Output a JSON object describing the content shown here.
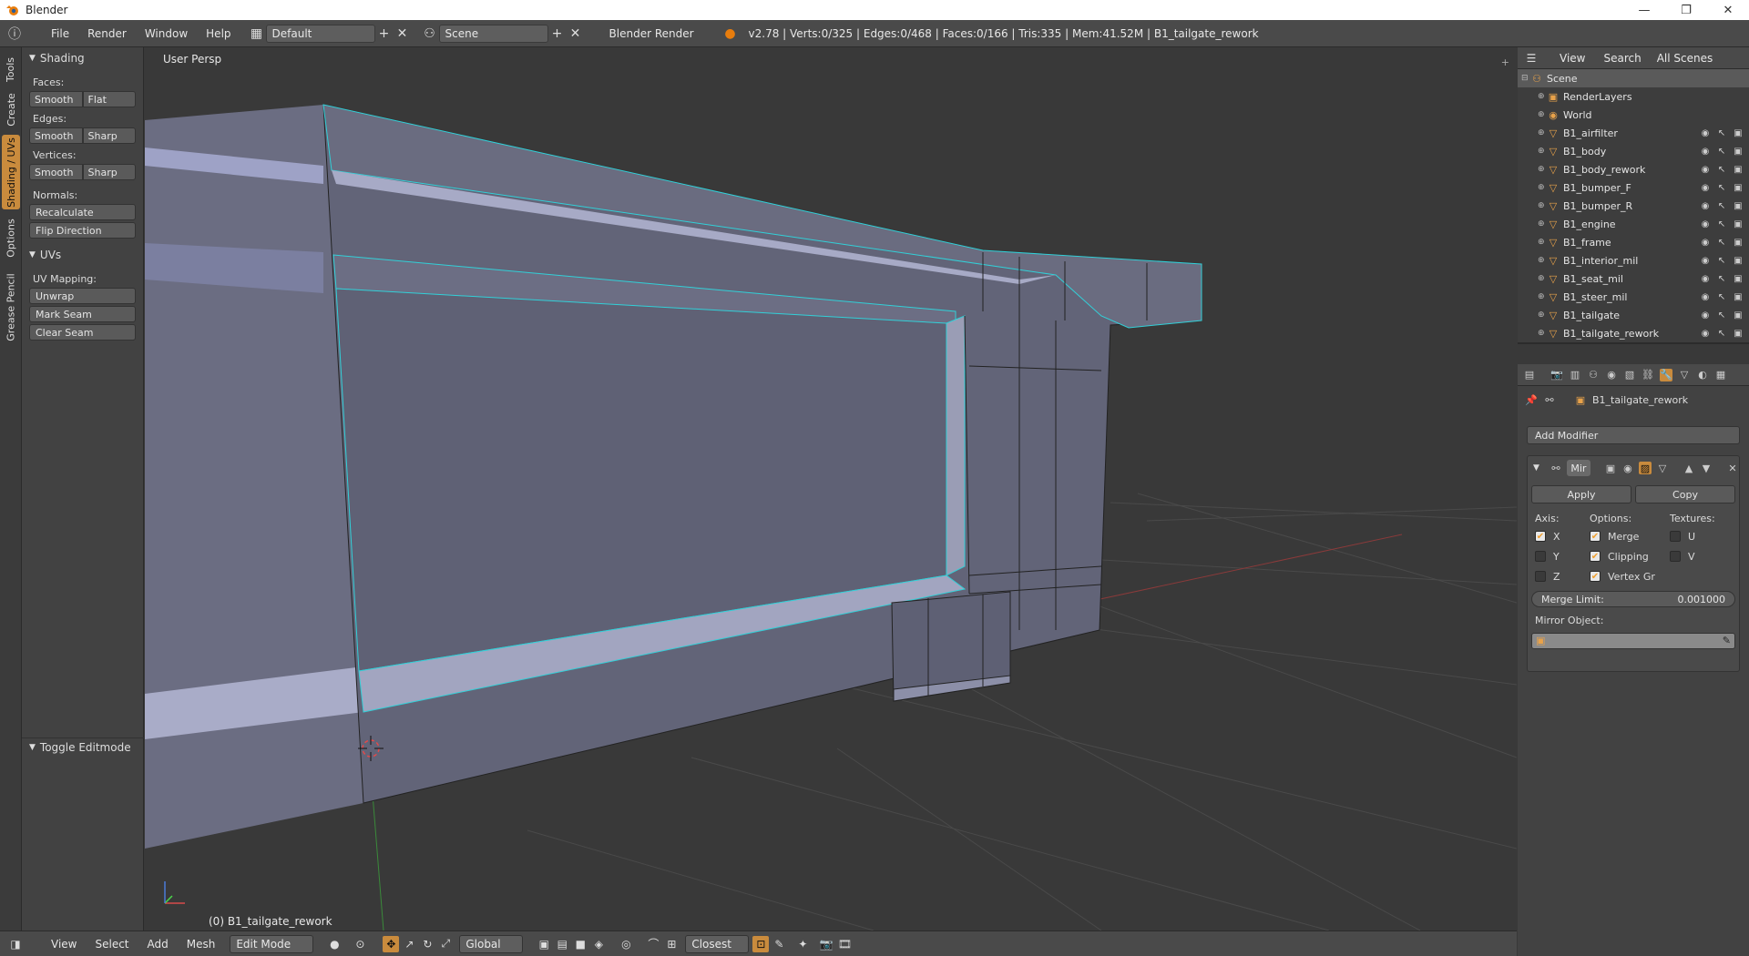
{
  "window": {
    "title": "Blender",
    "controls": [
      "—",
      "❐",
      "✕"
    ]
  },
  "menu": [
    "File",
    "Render",
    "Window",
    "Help"
  ],
  "screen_layout": "Default",
  "scene": "Scene",
  "render_engine": "Blender Render",
  "stats": "v2.78 | Verts:0/325 | Edges:0/468 | Faces:0/166 | Tris:335 | Mem:41.52M | B1_tailgate_rework",
  "left_tabs": [
    "Tools",
    "Create",
    "Shading / UVs",
    "Options",
    "Grease Pencil"
  ],
  "active_tab": "Shading / UVs",
  "shading_panel": {
    "title": "Shading",
    "faces_label": "Faces:",
    "faces_btns": [
      "Smooth",
      "Flat"
    ],
    "edges_label": "Edges:",
    "edges_btns": [
      "Smooth",
      "Sharp"
    ],
    "vertices_label": "Vertices:",
    "vertices_btns": [
      "Smooth",
      "Sharp"
    ],
    "normals_label": "Normals:",
    "normals_btns": [
      "Recalculate",
      "Flip Direction"
    ]
  },
  "uvs_panel": {
    "title": "UVs",
    "mapping_label": "UV Mapping:",
    "unwrap": "Unwrap",
    "mark_seam": "Mark Seam",
    "clear_seam": "Clear Seam"
  },
  "toggle_panel": "Toggle Editmode",
  "viewport": {
    "view_name": "User Persp",
    "object_label": "(0) B1_tailgate_rework"
  },
  "bottom": {
    "menus": [
      "View",
      "Select",
      "Add",
      "Mesh"
    ],
    "mode": "Edit Mode",
    "orientation": "Global",
    "snap": "Closest"
  },
  "outliner": {
    "header": [
      "View",
      "Search",
      "All Scenes"
    ],
    "rows": [
      {
        "name": "Scene",
        "level": 0,
        "icon": "scene-icon"
      },
      {
        "name": "RenderLayers",
        "level": 1,
        "icon": "render-icon"
      },
      {
        "name": "World",
        "level": 1,
        "icon": "world-icon"
      },
      {
        "name": "B1_airfilter",
        "level": 1,
        "icon": "mesh-icon"
      },
      {
        "name": "B1_body",
        "level": 1,
        "icon": "mesh-icon"
      },
      {
        "name": "B1_body_rework",
        "level": 1,
        "icon": "mesh-icon"
      },
      {
        "name": "B1_bumper_F",
        "level": 1,
        "icon": "mesh-icon"
      },
      {
        "name": "B1_bumper_R",
        "level": 1,
        "icon": "mesh-icon"
      },
      {
        "name": "B1_engine",
        "level": 1,
        "icon": "mesh-icon"
      },
      {
        "name": "B1_frame",
        "level": 1,
        "icon": "mesh-icon"
      },
      {
        "name": "B1_interior_mil",
        "level": 1,
        "icon": "mesh-icon"
      },
      {
        "name": "B1_seat_mil",
        "level": 1,
        "icon": "mesh-icon"
      },
      {
        "name": "B1_steer_mil",
        "level": 1,
        "icon": "mesh-icon"
      },
      {
        "name": "B1_tailgate",
        "level": 1,
        "icon": "mesh-icon"
      },
      {
        "name": "B1_tailgate_rework",
        "level": 1,
        "icon": "mesh-icon"
      }
    ]
  },
  "properties": {
    "object_name": "B1_tailgate_rework",
    "add_modifier": "Add Modifier",
    "modifier_name": "Mir",
    "apply": "Apply",
    "copy": "Copy",
    "axis_label": "Axis:",
    "options_label": "Options:",
    "textures_label": "Textures:",
    "axis": [
      {
        "name": "X",
        "on": true
      },
      {
        "name": "Y",
        "on": false
      },
      {
        "name": "Z",
        "on": false
      }
    ],
    "options": [
      {
        "name": "Merge",
        "on": true
      },
      {
        "name": "Clipping",
        "on": true
      },
      {
        "name": "Vertex Gr",
        "on": true
      }
    ],
    "textures": [
      {
        "name": "U",
        "on": false
      },
      {
        "name": "V",
        "on": false
      }
    ],
    "merge_limit_label": "Merge Limit:",
    "merge_limit_value": "0.001000",
    "mirror_object_label": "Mirror Object:"
  }
}
